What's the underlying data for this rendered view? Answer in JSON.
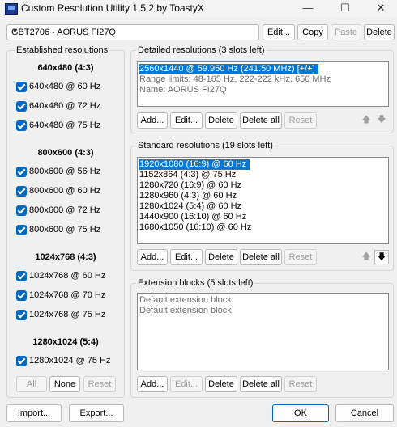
{
  "window": {
    "title": "Custom Resolution Utility 1.5.2 by ToastyX",
    "minimize": "—",
    "maximize": "☐",
    "close": "✕"
  },
  "monitor": {
    "selected": "GBT2706 - AORUS FI27Q",
    "edit_label": "Edit...",
    "copy_label": "Copy",
    "paste_label": "Paste",
    "delete_label": "Delete"
  },
  "established": {
    "title": "Established resolutions",
    "sections": [
      {
        "header": "640x480 (4:3)",
        "items": [
          "640x480 @ 60 Hz",
          "640x480 @ 72 Hz",
          "640x480 @ 75 Hz"
        ]
      },
      {
        "header": "800x600 (4:3)",
        "items": [
          "800x600 @ 56 Hz",
          "800x600 @ 60 Hz",
          "800x600 @ 72 Hz",
          "800x600 @ 75 Hz"
        ]
      },
      {
        "header": "1024x768 (4:3)",
        "items": [
          "1024x768 @ 60 Hz",
          "1024x768 @ 70 Hz",
          "1024x768 @ 75 Hz"
        ]
      },
      {
        "header": "1280x1024 (5:4)",
        "items": [
          "1280x1024 @ 75 Hz"
        ]
      }
    ],
    "all_label": "All",
    "none_label": "None",
    "reset_label": "Reset"
  },
  "detailed": {
    "title": "Detailed resolutions (3 slots left)",
    "items": [
      "2560x1440 @ 59.950 Hz (241.50 MHz) [+/+]",
      "Range limits: 48-165 Hz, 222-222 kHz, 650 MHz",
      "Name: AORUS FI27Q"
    ],
    "add_label": "Add...",
    "edit_label": "Edit...",
    "delete_label": "Delete",
    "delete_all_label": "Delete all",
    "reset_label": "Reset",
    "up_arrow": "🡅",
    "down_arrow": "🡇"
  },
  "standard": {
    "title": "Standard resolutions (19 slots left)",
    "items": [
      "1920x1080 (16:9) @ 60 Hz",
      "1152x864 (4:3) @ 75 Hz",
      "1280x720 (16:9) @ 60 Hz",
      "1280x960 (4:3) @ 60 Hz",
      "1280x1024 (5:4) @ 60 Hz",
      "1440x900 (16:10) @ 60 Hz",
      "1680x1050 (16:10) @ 60 Hz"
    ],
    "add_label": "Add...",
    "edit_label": "Edit...",
    "delete_label": "Delete",
    "delete_all_label": "Delete all",
    "reset_label": "Reset",
    "up_arrow": "🡅",
    "down_arrow": "🡇"
  },
  "extension": {
    "title": "Extension blocks (5 slots left)",
    "items": [
      "Default extension block",
      "Default extension block"
    ],
    "add_label": "Add...",
    "edit_label": "Edit...",
    "delete_label": "Delete",
    "delete_all_label": "Delete all",
    "reset_label": "Reset"
  },
  "footer": {
    "import_label": "Import...",
    "export_label": "Export...",
    "ok_label": "OK",
    "cancel_label": "Cancel"
  },
  "colors": {
    "accent": "#0067c0",
    "selection": "#0078d7"
  }
}
